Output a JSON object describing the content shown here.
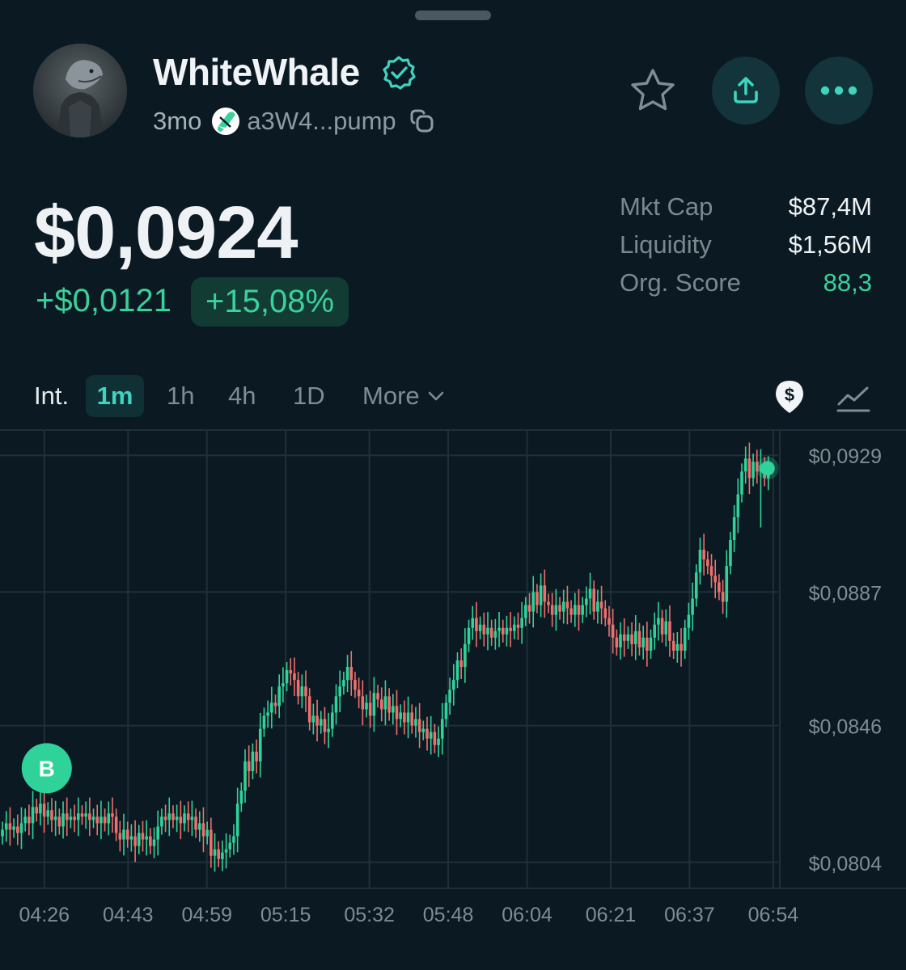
{
  "token": {
    "name": "WhiteWhale",
    "age": "3mo",
    "address": "a3W4...pump"
  },
  "price": {
    "current": "$0,0924",
    "change_abs": "+$0,0121",
    "change_pct": "+15,08%"
  },
  "stats": [
    {
      "label": "Mkt Cap",
      "value": "$87,4M"
    },
    {
      "label": "Liquidity",
      "value": "$1,56M"
    },
    {
      "label": "Org. Score",
      "value": "88,3"
    }
  ],
  "intervals": {
    "label": "Int.",
    "options": [
      "1m",
      "1h",
      "4h",
      "1D"
    ],
    "selected": "1m",
    "more": "More"
  },
  "icons": {
    "verified": "verified-badge-icon",
    "pill": "pill-icon",
    "copy": "copy-icon",
    "star": "star-icon",
    "share": "share-icon",
    "more": "more-icon",
    "price_toggle": "dollar-pin-icon",
    "chart_type": "line-chart-icon"
  },
  "colors": {
    "background": "#0b1a22",
    "up": "#2fd39a",
    "down": "#ef6f6c",
    "accent": "#3fd3c0",
    "grid": "#1f3038"
  },
  "chart_data": {
    "type": "candlestick",
    "title": "",
    "xlabel": "",
    "ylabel": "",
    "x_ticks": [
      "04:26",
      "04:43",
      "04:59",
      "05:15",
      "05:32",
      "05:48",
      "06:04",
      "06:21",
      "06:37",
      "06:54"
    ],
    "y_ticks": [
      "$0,0804",
      "$0,0846",
      "$0,0887",
      "$0,0929"
    ],
    "y_tick_values": [
      0.0804,
      0.0846,
      0.0887,
      0.0929
    ],
    "ylim": [
      0.0796,
      0.0937
    ],
    "x_range": [
      "04:17",
      "06:55"
    ],
    "y_axis_side": "right",
    "grid": true,
    "marker": {
      "label": "B",
      "time": "04:26",
      "price": 0.082
    },
    "last_price_dot": {
      "time": "06:53",
      "price": 0.0925
    },
    "close_series": [
      0.0814,
      0.0816,
      0.0814,
      0.0815,
      0.0813,
      0.0816,
      0.0818,
      0.0816,
      0.0821,
      0.0819,
      0.0822,
      0.0818,
      0.082,
      0.0817,
      0.0818,
      0.0815,
      0.0819,
      0.0817,
      0.0818,
      0.0817,
      0.0819,
      0.0818,
      0.0819,
      0.0817,
      0.0818,
      0.0816,
      0.0818,
      0.0816,
      0.0819,
      0.0818,
      0.0813,
      0.0811,
      0.0814,
      0.0811,
      0.0812,
      0.0809,
      0.0813,
      0.0811,
      0.0812,
      0.0809,
      0.0811,
      0.0815,
      0.0818,
      0.0817,
      0.0819,
      0.0817,
      0.0818,
      0.0816,
      0.0819,
      0.0817,
      0.0818,
      0.0814,
      0.0816,
      0.0812,
      0.0814,
      0.0806,
      0.0808,
      0.0805,
      0.0807,
      0.0808,
      0.081,
      0.0812,
      0.0822,
      0.0826,
      0.0835,
      0.0832,
      0.0838,
      0.0835,
      0.0845,
      0.0849,
      0.085,
      0.0853,
      0.0852,
      0.0858,
      0.0859,
      0.0863,
      0.0862,
      0.086,
      0.0855,
      0.0858,
      0.0855,
      0.0847,
      0.0849,
      0.0846,
      0.0848,
      0.0844,
      0.0845,
      0.085,
      0.0855,
      0.0858,
      0.086,
      0.0864,
      0.086,
      0.0857,
      0.0855,
      0.0851,
      0.0853,
      0.0849,
      0.0856,
      0.0854,
      0.0851,
      0.0855,
      0.085,
      0.0852,
      0.0848,
      0.085,
      0.0847,
      0.085,
      0.0846,
      0.0848,
      0.0844,
      0.0845,
      0.0842,
      0.0844,
      0.084,
      0.0842,
      0.0848,
      0.0853,
      0.0857,
      0.086,
      0.0866,
      0.0864,
      0.0871,
      0.0876,
      0.0879,
      0.0875,
      0.0877,
      0.0874,
      0.0876,
      0.0873,
      0.0875,
      0.0876,
      0.0874,
      0.0876,
      0.0875,
      0.0877,
      0.0876,
      0.0879,
      0.0883,
      0.0881,
      0.0887,
      0.0883,
      0.0889,
      0.0884,
      0.0883,
      0.088,
      0.0883,
      0.0881,
      0.0884,
      0.0882,
      0.088,
      0.0883,
      0.088,
      0.0883,
      0.0885,
      0.0888,
      0.0881,
      0.0884,
      0.0882,
      0.0879,
      0.0877,
      0.0873,
      0.087,
      0.0874,
      0.0872,
      0.0874,
      0.0871,
      0.0875,
      0.087,
      0.0873,
      0.0869,
      0.0873,
      0.0877,
      0.0879,
      0.0874,
      0.0878,
      0.0872,
      0.0869,
      0.0871,
      0.0869,
      0.0876,
      0.088,
      0.0885,
      0.0893,
      0.09,
      0.0897,
      0.0895,
      0.0892,
      0.089,
      0.0887,
      0.0884,
      0.0895,
      0.0903,
      0.091,
      0.0917,
      0.0924,
      0.0928,
      0.0922,
      0.0927,
      0.0924,
      0.0926,
      0.0922,
      0.0925
    ]
  }
}
